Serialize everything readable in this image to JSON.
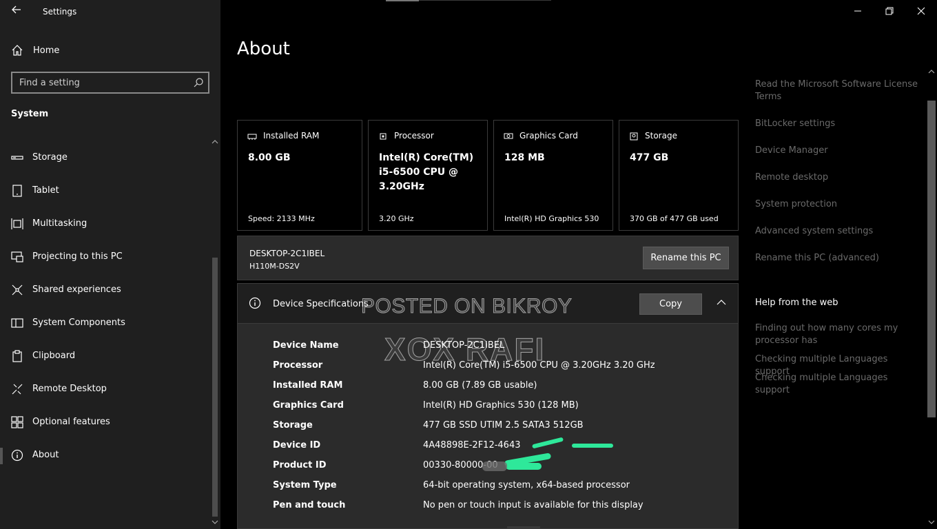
{
  "window": {
    "title": "Settings"
  },
  "sidebar": {
    "home_label": "Home",
    "search_placeholder": "Find a setting",
    "section_title": "System",
    "items": [
      {
        "label": "Storage",
        "icon": "storage-icon"
      },
      {
        "label": "Tablet",
        "icon": "tablet-icon"
      },
      {
        "label": "Multitasking",
        "icon": "multitasking-icon"
      },
      {
        "label": "Projecting to this PC",
        "icon": "projecting-icon"
      },
      {
        "label": "Shared experiences",
        "icon": "shared-experiences-icon"
      },
      {
        "label": "System Components",
        "icon": "system-components-icon"
      },
      {
        "label": "Clipboard",
        "icon": "clipboard-icon"
      },
      {
        "label": "Remote Desktop",
        "icon": "remote-desktop-icon"
      },
      {
        "label": "Optional features",
        "icon": "optional-features-icon"
      },
      {
        "label": "About",
        "icon": "info-icon",
        "active": true
      }
    ]
  },
  "main": {
    "title": "About",
    "cards": [
      {
        "header": "Installed RAM",
        "icon": "ram-icon",
        "value": "8.00 GB",
        "sub": "Speed: 2133 MHz"
      },
      {
        "header": "Processor",
        "icon": "processor-icon",
        "value": "Intel(R) Core(TM) i5-6500 CPU @ 3.20GHz",
        "sub": "3.20 GHz"
      },
      {
        "header": "Graphics Card",
        "icon": "graphics-card-icon",
        "value": "128 MB",
        "sub": "Intel(R) HD Graphics 530"
      },
      {
        "header": "Storage",
        "icon": "storage-drive-icon",
        "value": "477 GB",
        "sub": "370 GB of 477 GB used"
      }
    ],
    "pc": {
      "name": "DESKTOP-2C1IBEL",
      "model": "H110M-DS2V",
      "rename_label": "Rename this PC"
    },
    "specs": {
      "header": "Device Specifications",
      "copy_label": "Copy",
      "rows": [
        {
          "key": "Device Name",
          "value": "DESKTOP-2C1IBEL"
        },
        {
          "key": "Processor",
          "value": "Intel(R) Core(TM) i5-6500 CPU @ 3.20GHz   3.20 GHz"
        },
        {
          "key": "Installed RAM",
          "value": "8.00 GB (7.89 GB usable)"
        },
        {
          "key": "Graphics Card",
          "value": "Intel(R) HD Graphics 530 (128 MB)"
        },
        {
          "key": "Storage",
          "value": "477 GB SSD UTIM 2.5 SATA3 512GB"
        },
        {
          "key": "Device ID",
          "value": "4A48898E-2F12-4643"
        },
        {
          "key": "Product ID",
          "value": "00330-80000-00"
        },
        {
          "key": "System Type",
          "value": "64-bit operating system, x64-based processor"
        },
        {
          "key": "Pen and touch",
          "value": "No pen or touch input is available for this display"
        }
      ]
    },
    "watermarks": {
      "line1": "POSTED ON BIKROY",
      "line2": "XOX RAFI"
    }
  },
  "related": {
    "links": [
      "Read the Microsoft Software License Terms",
      "BitLocker settings",
      "Device Manager",
      "Remote desktop",
      "System protection",
      "Advanced system settings",
      "Rename this PC (advanced)"
    ],
    "web_header": "Help from the web",
    "web_links": [
      "Finding out how many cores my processor has",
      "Checking multiple Languages support",
      "Checking multiple Languages support"
    ]
  },
  "colors": {
    "sidebar_bg": "#1f1f1f",
    "page_bg": "#000000",
    "panel_bg": "#2b2b2b",
    "button_bg": "#4d4d4d",
    "muted_link": "#6a6a6a",
    "redaction": "#2ee89a"
  }
}
